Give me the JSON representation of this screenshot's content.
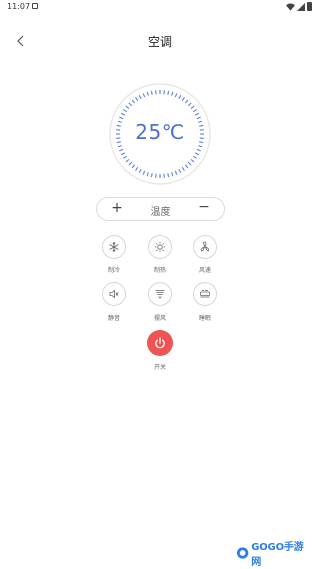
{
  "status_bar": {
    "time": "11:07"
  },
  "header": {
    "title": "空调"
  },
  "dial": {
    "temperature": "25℃",
    "colors": {
      "ticks": "#5b7fe0",
      "ring": "#e6e6e6"
    }
  },
  "temp_control": {
    "plus": "+",
    "label": "温度",
    "minus": "−"
  },
  "modes": [
    {
      "label": "制冷",
      "icon": "snowflake-icon"
    },
    {
      "label": "制热",
      "icon": "sun-icon"
    },
    {
      "label": "风速",
      "icon": "fan-icon"
    },
    {
      "label": "静音",
      "icon": "speaker-icon"
    },
    {
      "label": "摆风",
      "icon": "swing-icon"
    },
    {
      "label": "睡眠",
      "icon": "sleep-icon"
    }
  ],
  "power": {
    "label": "开关",
    "color": "#ee5454"
  },
  "watermark": {
    "text": "GOGO手游网"
  }
}
